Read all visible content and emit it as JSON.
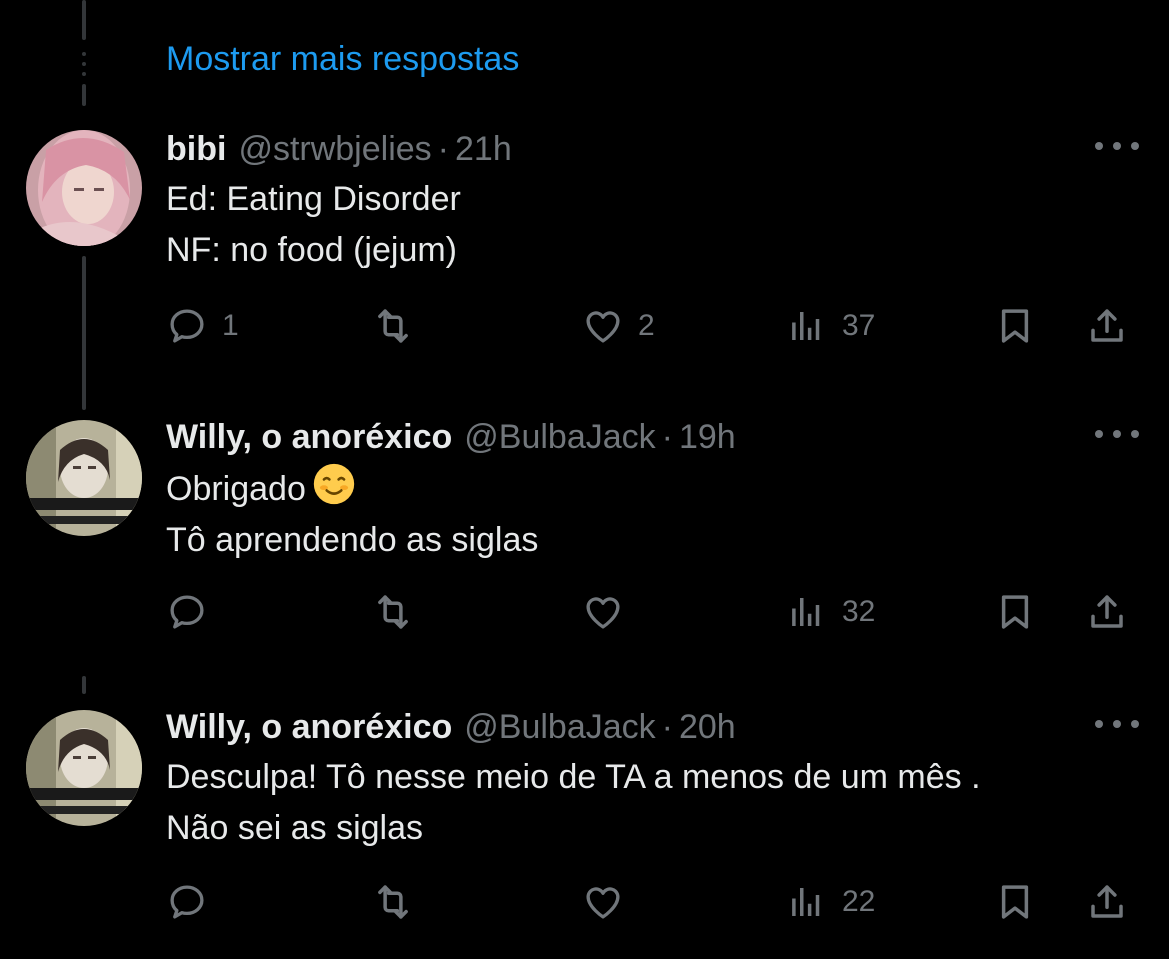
{
  "thread": {
    "show_more_label": "Mostrar mais respostas"
  },
  "tweets": [
    {
      "name": "bibi",
      "handle": "@strwbjelies",
      "separator": "·",
      "time": "21h",
      "lines": [
        "Ed: Eating Disorder",
        "NF: no food (jejum)"
      ],
      "replies": "1",
      "retweets": "",
      "likes": "2",
      "views": "37"
    },
    {
      "name": "Willy, o anoréxico",
      "handle": "@BulbaJack",
      "separator": "·",
      "time": "19h",
      "lines": [
        "Obrigado",
        "Tô aprendendo as siglas"
      ],
      "emoji": "smiling-face-emoji",
      "replies": "",
      "retweets": "",
      "likes": "",
      "views": "32"
    },
    {
      "name": "Willy, o anoréxico",
      "handle": "@BulbaJack",
      "separator": "·",
      "time": "20h",
      "lines": [
        "Desculpa! Tô nesse meio de TA a menos de um mês .",
        "Não sei as siglas"
      ],
      "replies": "",
      "retweets": "",
      "likes": "",
      "views": "22"
    }
  ],
  "colors": {
    "background": "#000000",
    "link": "#1d9bf0",
    "primary_text": "#e7e9ea",
    "secondary_text": "#71767b",
    "thread_line": "#333639"
  }
}
